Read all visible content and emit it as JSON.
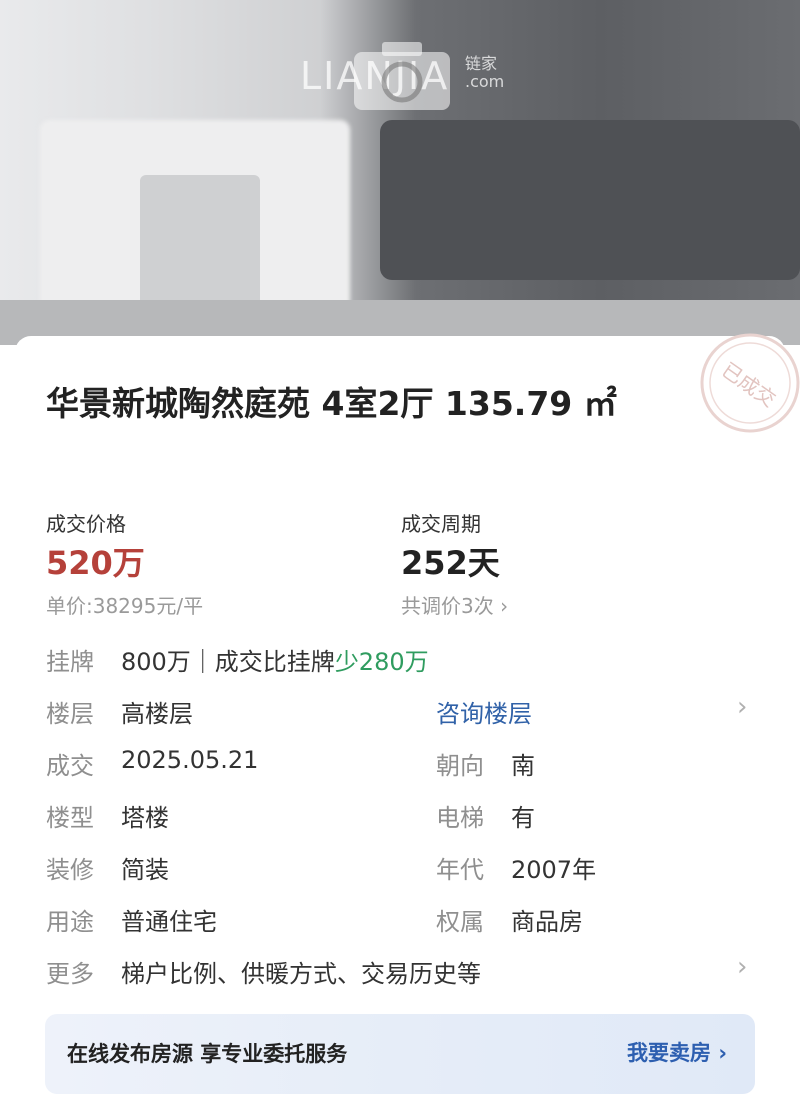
{
  "photo": {
    "watermark_text": "LIANJIA",
    "watermark_cn": "链家",
    "watermark_com": ".com"
  },
  "listing": {
    "title": "华景新城陶然庭苑 4室2厅 135.79 ㎡",
    "stamp_text": "已成交",
    "deal_price_label": "成交价格",
    "deal_price": "520万",
    "unit_price": "单价:38295元/平",
    "deal_cycle_label": "成交周期",
    "deal_cycle": "252天",
    "price_adjust": "共调价3次"
  },
  "details": {
    "listing": {
      "label": "挂牌",
      "value_prefix": "800万｜成交比挂牌",
      "value_diff": "少280万"
    },
    "floor": {
      "label": "楼层",
      "value": "高楼层",
      "link": "咨询楼层"
    },
    "deal_date": {
      "label": "成交",
      "value": "2025.05.21"
    },
    "orientation": {
      "label": "朝向",
      "value": "南"
    },
    "building_type": {
      "label": "楼型",
      "value": "塔楼"
    },
    "elevator": {
      "label": "电梯",
      "value": "有"
    },
    "decoration": {
      "label": "装修",
      "value": "简装"
    },
    "year": {
      "label": "年代",
      "value": "2007年"
    },
    "usage": {
      "label": "用途",
      "value": "普通住宅"
    },
    "ownership": {
      "label": "权属",
      "value": "商品房"
    },
    "more": {
      "label": "更多",
      "value": "梯户比例、供暖方式、交易历史等"
    }
  },
  "banner": {
    "text": "在线发布房源 享专业委托服务",
    "button": "我要卖房"
  },
  "colors": {
    "price_red": "#b5413a",
    "diff_green": "#2f9c5f",
    "link_blue": "#3162a8",
    "banner_blue": "#2d5fb0"
  },
  "icons": {
    "chevron": "chevron-right-icon",
    "camera": "camera-icon",
    "stamp": "deal-stamp-icon"
  }
}
